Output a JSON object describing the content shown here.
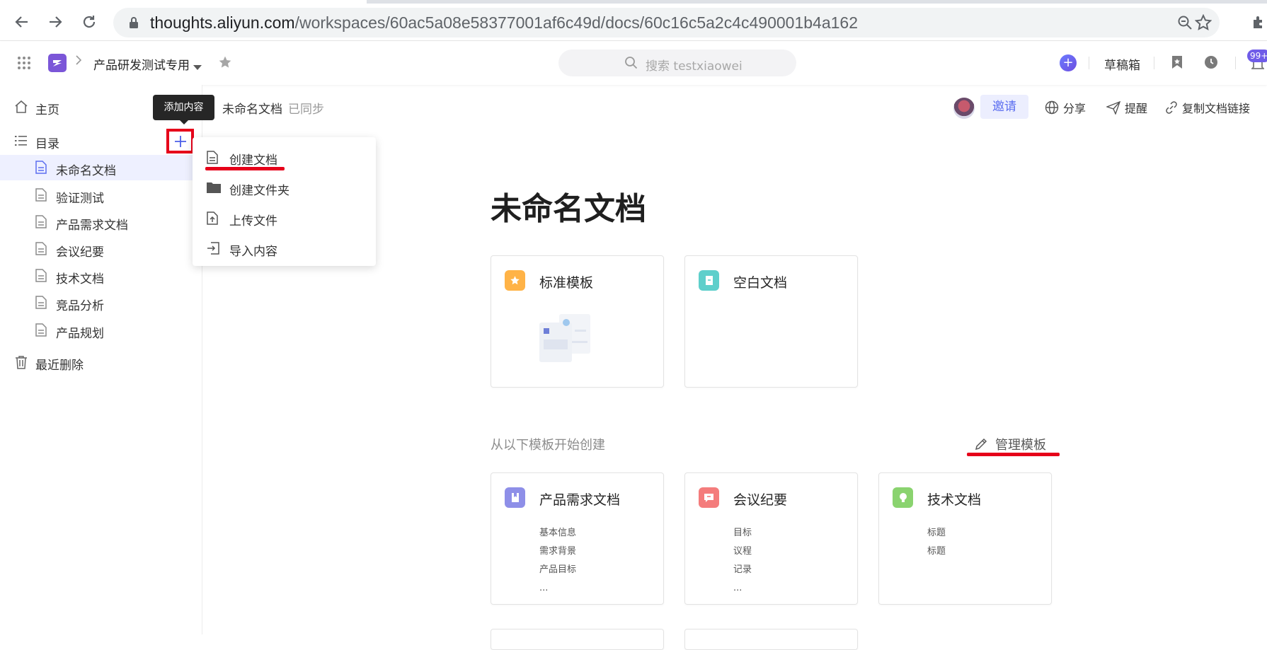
{
  "browser": {
    "url_host": "thoughts.aliyun.com",
    "url_path": "/workspaces/60ac5a08e58377001af6c49d/docs/60c16c5a2c4c490001b4a162",
    "icons": [
      "back-icon",
      "forward-icon",
      "reload-icon",
      "lock-icon",
      "zoom-icon",
      "bookmark-star-icon",
      "extensions-icon"
    ]
  },
  "header": {
    "workspace_name": "产品研发测试专用",
    "search_placeholder": "搜索 testxiaowei",
    "drafts_label": "草稿箱",
    "notification_badge": "99+",
    "colors": {
      "logo": "#7b56d8",
      "accent": "#5b6ef0"
    }
  },
  "sidebar": {
    "home_label": "主页",
    "toc_label": "目录",
    "add_tooltip": "添加内容",
    "docs": [
      {
        "label": "未命名文档",
        "active": true
      },
      {
        "label": "验证测试"
      },
      {
        "label": "产品需求文档"
      },
      {
        "label": "会议纪要"
      },
      {
        "label": "技术文档"
      },
      {
        "label": "竞品分析"
      },
      {
        "label": "产品规划"
      }
    ],
    "trash_label": "最近删除"
  },
  "add_menu": {
    "items": [
      {
        "label": "创建文档",
        "icon": "document-icon"
      },
      {
        "label": "创建文件夹",
        "icon": "folder-icon"
      },
      {
        "label": "上传文件",
        "icon": "upload-icon"
      },
      {
        "label": "导入内容",
        "icon": "import-icon"
      }
    ]
  },
  "doc": {
    "breadcrumb_title": "未命名文档",
    "sync_status": "已同步",
    "invite_label": "邀请",
    "share_label": "分享",
    "remind_label": "提醒",
    "copy_link_label": "复制文档链接",
    "title": "未命名文档"
  },
  "start_cards": [
    {
      "title": "标准模板",
      "color": "#ffb347"
    },
    {
      "title": "空白文档",
      "color": "#5ecfcb"
    }
  ],
  "templates": {
    "section_title": "从以下模板开始创建",
    "manage_label": "管理模板",
    "cards": [
      {
        "title": "产品需求文档",
        "color": "#8e8fe8",
        "lines": [
          "基本信息",
          "需求背景",
          "产品目标",
          "..."
        ]
      },
      {
        "title": "会议纪要",
        "color": "#f47c7c",
        "lines": [
          "目标",
          "议程",
          "记录",
          "..."
        ]
      },
      {
        "title": "技术文档",
        "color": "#8ad36f",
        "lines": [
          "标题",
          "标题"
        ]
      }
    ]
  }
}
